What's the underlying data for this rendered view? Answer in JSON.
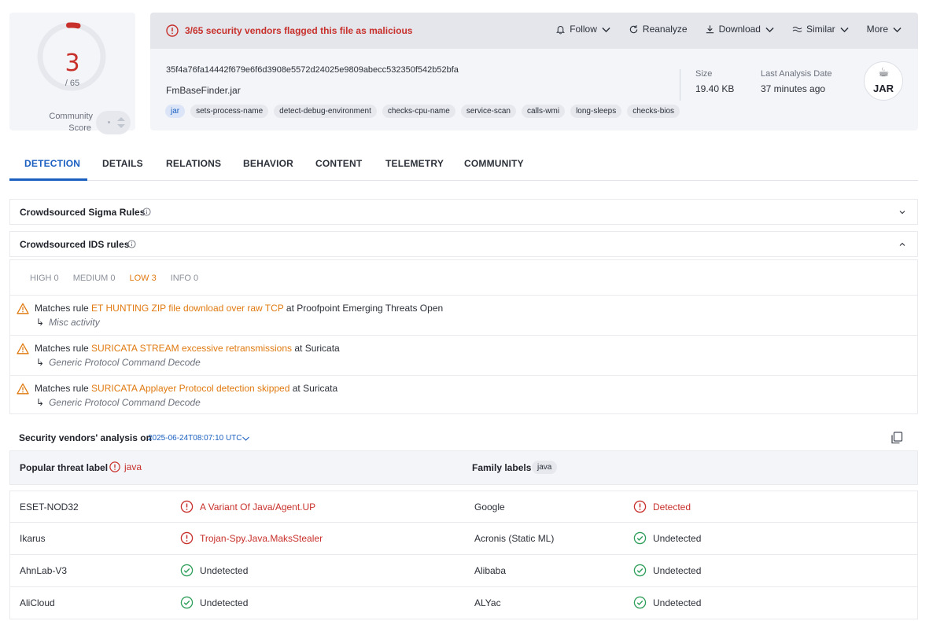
{
  "score": {
    "detections": "3",
    "total": "/ 65",
    "detected_count": 3,
    "engine_count": 65,
    "community_label_line1": "Community",
    "community_label_line2": "Score"
  },
  "alert": {
    "text": "3/65 security vendors flagged this file as malicious",
    "color": "#c8302b"
  },
  "actions": {
    "follow": "Follow",
    "reanalyze": "Reanalyze",
    "download": "Download",
    "similar": "Similar",
    "more": "More"
  },
  "file": {
    "hash": "35f4a76fa14442f679e6f6d3908e5572d24025e9809abecc532350f542b52bfa",
    "name": "FmBaseFinder.jar",
    "tags": [
      "jar",
      "sets-process-name",
      "detect-debug-environment",
      "checks-cpu-name",
      "service-scan",
      "calls-wmi",
      "long-sleeps",
      "checks-bios"
    ],
    "size_label": "Size",
    "size_value": "19.40 KB",
    "date_label": "Last Analysis Date",
    "date_value": "37 minutes ago",
    "type_icon": "JAR"
  },
  "tabs": [
    "DETECTION",
    "DETAILS",
    "RELATIONS",
    "BEHAVIOR",
    "CONTENT",
    "TELEMETRY",
    "COMMUNITY"
  ],
  "sigma": {
    "title": "Crowdsourced Sigma Rules"
  },
  "ids": {
    "title": "Crowdsourced IDS rules",
    "severity_tabs": {
      "high": "HIGH 0",
      "medium": "MEDIUM 0",
      "low": "LOW 3",
      "info": "INFO 0"
    },
    "matches_prefix": "Matches rule",
    "at_word": "at",
    "rows": [
      {
        "rule": "ET HUNTING ZIP file download over raw TCP",
        "source": "Proofpoint Emerging Threats Open",
        "category": "Misc activity"
      },
      {
        "rule": "SURICATA STREAM excessive retransmissions",
        "source": "Suricata",
        "category": "Generic Protocol Command Decode"
      },
      {
        "rule": "SURICATA Applayer Protocol detection skipped",
        "source": "Suricata",
        "category": "Generic Protocol Command Decode"
      }
    ]
  },
  "vendors": {
    "heading": "Security vendors' analysis on",
    "date": "2025-06-24T08:07:10 UTC",
    "popular_label": "Popular threat label",
    "popular_value": "java",
    "family_label": "Family labels",
    "family_value": "java",
    "rows": [
      {
        "left_engine": "ESET-NOD32",
        "left_result": "A Variant Of Java/Agent.UP",
        "left_status": "malicious",
        "right_engine": "Google",
        "right_result": "Detected",
        "right_status": "malicious"
      },
      {
        "left_engine": "Ikarus",
        "left_result": "Trojan-Spy.Java.MaksStealer",
        "left_status": "malicious",
        "right_engine": "Acronis (Static ML)",
        "right_result": "Undetected",
        "right_status": "clean"
      },
      {
        "left_engine": "AhnLab-V3",
        "left_result": "Undetected",
        "left_status": "clean",
        "right_engine": "Alibaba",
        "right_result": "Undetected",
        "right_status": "clean"
      },
      {
        "left_engine": "AliCloud",
        "left_result": "Undetected",
        "left_status": "clean",
        "right_engine": "ALYac",
        "right_result": "Undetected",
        "right_status": "clean"
      }
    ]
  }
}
